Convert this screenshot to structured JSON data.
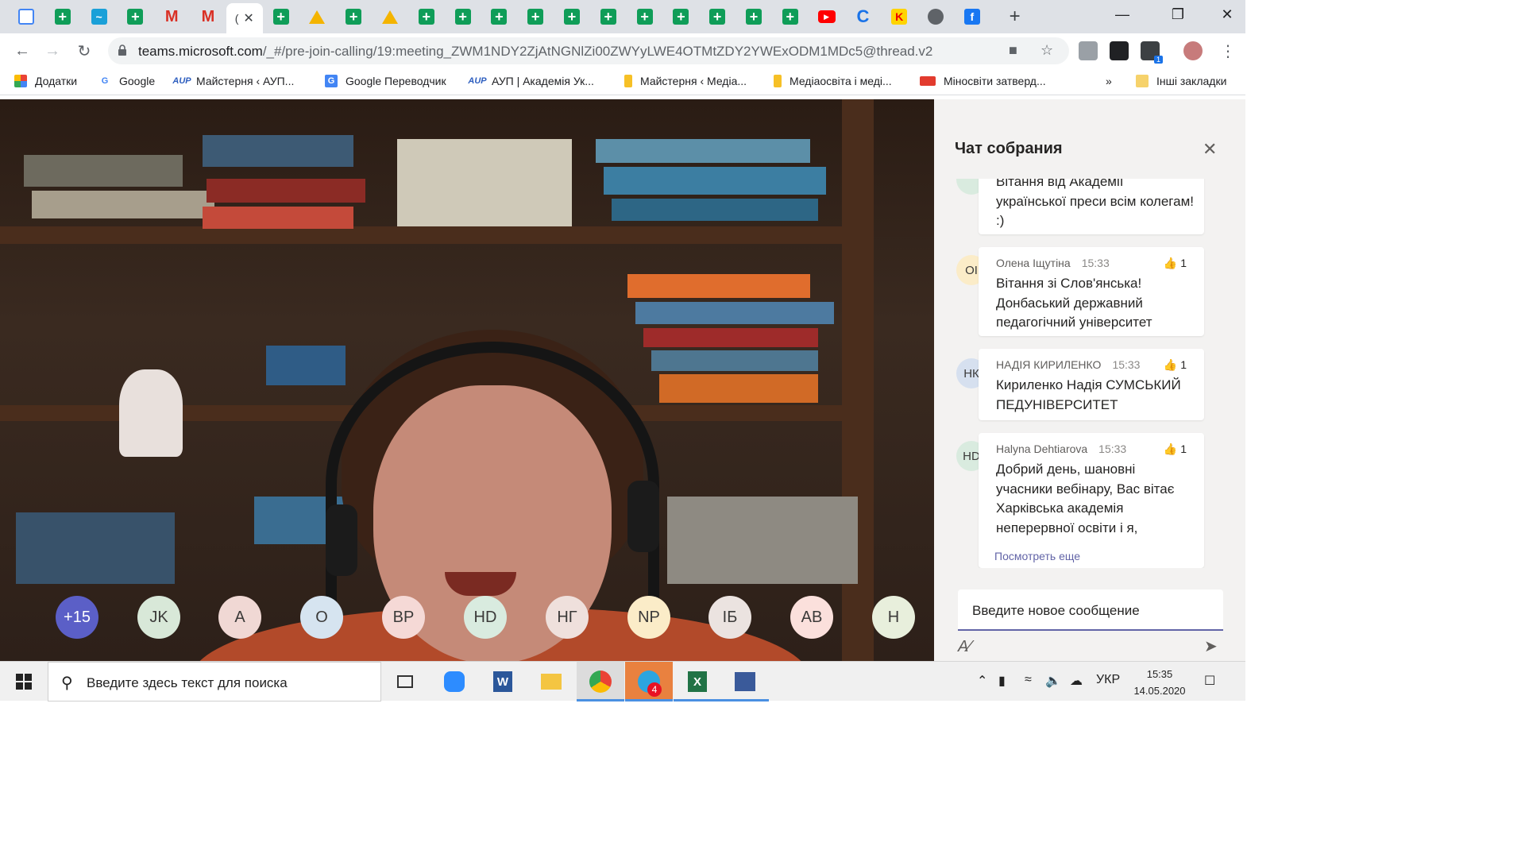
{
  "browser": {
    "tabs": [
      {
        "icon": "calculator-icon"
      },
      {
        "icon": "sheets-icon"
      },
      {
        "icon": "activity-icon"
      },
      {
        "icon": "sheets-icon"
      },
      {
        "icon": "gmail-icon"
      },
      {
        "icon": "gmail-icon"
      },
      {
        "icon": "active-tab",
        "label": "("
      },
      {
        "icon": "sheets-icon"
      },
      {
        "icon": "drive-icon"
      },
      {
        "icon": "sheets-icon"
      },
      {
        "icon": "drive-icon"
      },
      {
        "icon": "sheets-icon"
      },
      {
        "icon": "sheets-icon"
      },
      {
        "icon": "sheets-icon"
      },
      {
        "icon": "sheets-icon"
      },
      {
        "icon": "sheets-icon"
      },
      {
        "icon": "sheets-icon"
      },
      {
        "icon": "sheets-icon"
      },
      {
        "icon": "sheets-icon"
      },
      {
        "icon": "sheets-icon"
      },
      {
        "icon": "sheets-icon"
      },
      {
        "icon": "sheets-icon"
      },
      {
        "icon": "youtube-icon"
      },
      {
        "icon": "c-icon"
      },
      {
        "icon": "ki-icon"
      },
      {
        "icon": "globe-icon"
      },
      {
        "icon": "facebook-icon"
      }
    ],
    "new_tab": "+",
    "url_host": "teams.microsoft.com",
    "url_path": "/_#/pre-join-calling/19:meeting_ZWM1NDY2ZjAtNGNlZi00ZWYyLWE4OTMtZDY2YWExODM1MDc5@thread.v2",
    "extension_badge": "1",
    "bookmarks": [
      {
        "label": "Додатки",
        "icon": "apps-icon"
      },
      {
        "label": "Google",
        "icon": "google-icon"
      },
      {
        "label": "Майстерня ‹ АУП...",
        "icon": "aup-icon"
      },
      {
        "label": "Google Переводчик",
        "icon": "translate-icon"
      },
      {
        "label": "АУП | Академія Ук...",
        "icon": "aup-icon"
      },
      {
        "label": "Майстерня ‹ Медіа...",
        "icon": "folder-icon"
      },
      {
        "label": "Медіаосвіта і меді...",
        "icon": "folder-icon"
      },
      {
        "label": "Міносвіти затверд...",
        "icon": "news-icon"
      }
    ],
    "bookmarks_more": "»",
    "other_bookmarks": "Інші закладки"
  },
  "participants": {
    "overflow": "+15",
    "list": [
      {
        "initials": "JK",
        "color": "#d8e8d8"
      },
      {
        "initials": "A",
        "color": "#f0d8d4"
      },
      {
        "initials": "O",
        "color": "#d6e4f0"
      },
      {
        "initials": "BP",
        "color": "#f5d9d6"
      },
      {
        "initials": "HD",
        "color": "#d9ebdf"
      },
      {
        "initials": "НГ",
        "color": "#efe0dc"
      },
      {
        "initials": "NP",
        "color": "#fbecc8"
      },
      {
        "initials": "ІБ",
        "color": "#ebe3e0"
      },
      {
        "initials": "AB",
        "color": "#fbe0dc"
      },
      {
        "initials": "H",
        "color": "#e8efdc"
      }
    ],
    "overflow_color": "#5b5fc7"
  },
  "chat": {
    "title": "Чат собрания",
    "messages": [
      {
        "author": "",
        "time": "",
        "likes": "",
        "body": "Вітання від Академії української преси всім колегам! :)",
        "avatar": "",
        "avatar_color": "#d9ebdf"
      },
      {
        "author": "Олена Іщутіна",
        "time": "15:33",
        "likes": "1",
        "body": "Вітання зі Слов'янська! Донбаський державний педагогічний університет",
        "avatar": "OI",
        "avatar_color": "#fbecc8"
      },
      {
        "author": "НАДІЯ КИРИЛЕНКО",
        "time": "15:33",
        "likes": "1",
        "body": "Кириленко Надія СУМСЬКИЙ ПЕДУНІВЕРСИТЕТ",
        "avatar": "НК",
        "avatar_color": "#d6e0ef"
      },
      {
        "author": "Halyna Dehtiarova",
        "time": "15:33",
        "likes": "1",
        "body": "Добрий день, шановні учасники вебінару, Вас вітає Харківська академія неперервної освіти і я,",
        "avatar": "HD",
        "avatar_color": "#d9ebdf"
      }
    ],
    "see_more": "Посмотреть еще",
    "compose_placeholder": "Введите новое сообщение"
  },
  "taskbar": {
    "search_placeholder": "Введите здесь текст для поиска",
    "apps": [
      "task-view-icon",
      "zoom-icon",
      "word-icon",
      "explorer-icon",
      "chrome-icon",
      "telegram-icon",
      "excel-icon",
      "app-icon"
    ],
    "telegram_badge": "4",
    "language": "УКР",
    "time": "15:35",
    "date": "14.05.2020"
  }
}
